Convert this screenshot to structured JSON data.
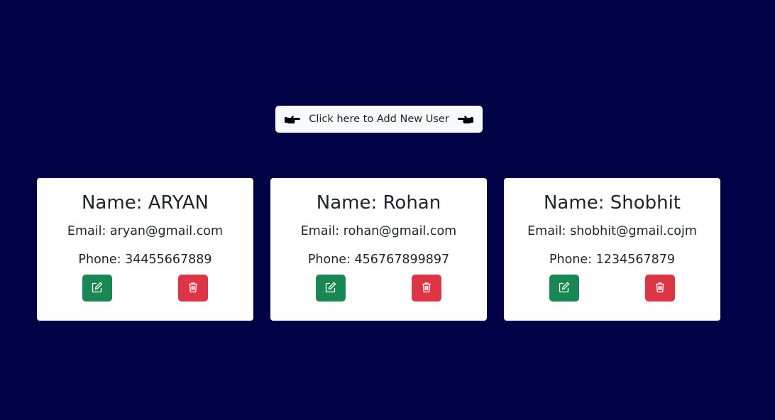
{
  "add_user": {
    "label": "Click here to Add New User",
    "left_icon": "hand-pointing-right-icon",
    "right_icon": "hand-pointing-left-icon"
  },
  "users": [
    {
      "name": "Name: ARYAN",
      "email": "Email: aryan@gmail.com",
      "phone": "Phone: 34455667889"
    },
    {
      "name": "Name: Rohan",
      "email": "Email: rohan@gmail.com",
      "phone": "Phone: 456767899897"
    },
    {
      "name": "Name: Shobhit",
      "email": "Email: shobhit@gmail.cojm",
      "phone": "Phone: 1234567879"
    }
  ],
  "actions": {
    "edit_icon": "edit-icon",
    "delete_icon": "trash-icon"
  },
  "colors": {
    "background": "#000245",
    "edit": "#198754",
    "delete": "#dc3545",
    "card": "#ffffff",
    "add_button": "#f8f9fa"
  }
}
